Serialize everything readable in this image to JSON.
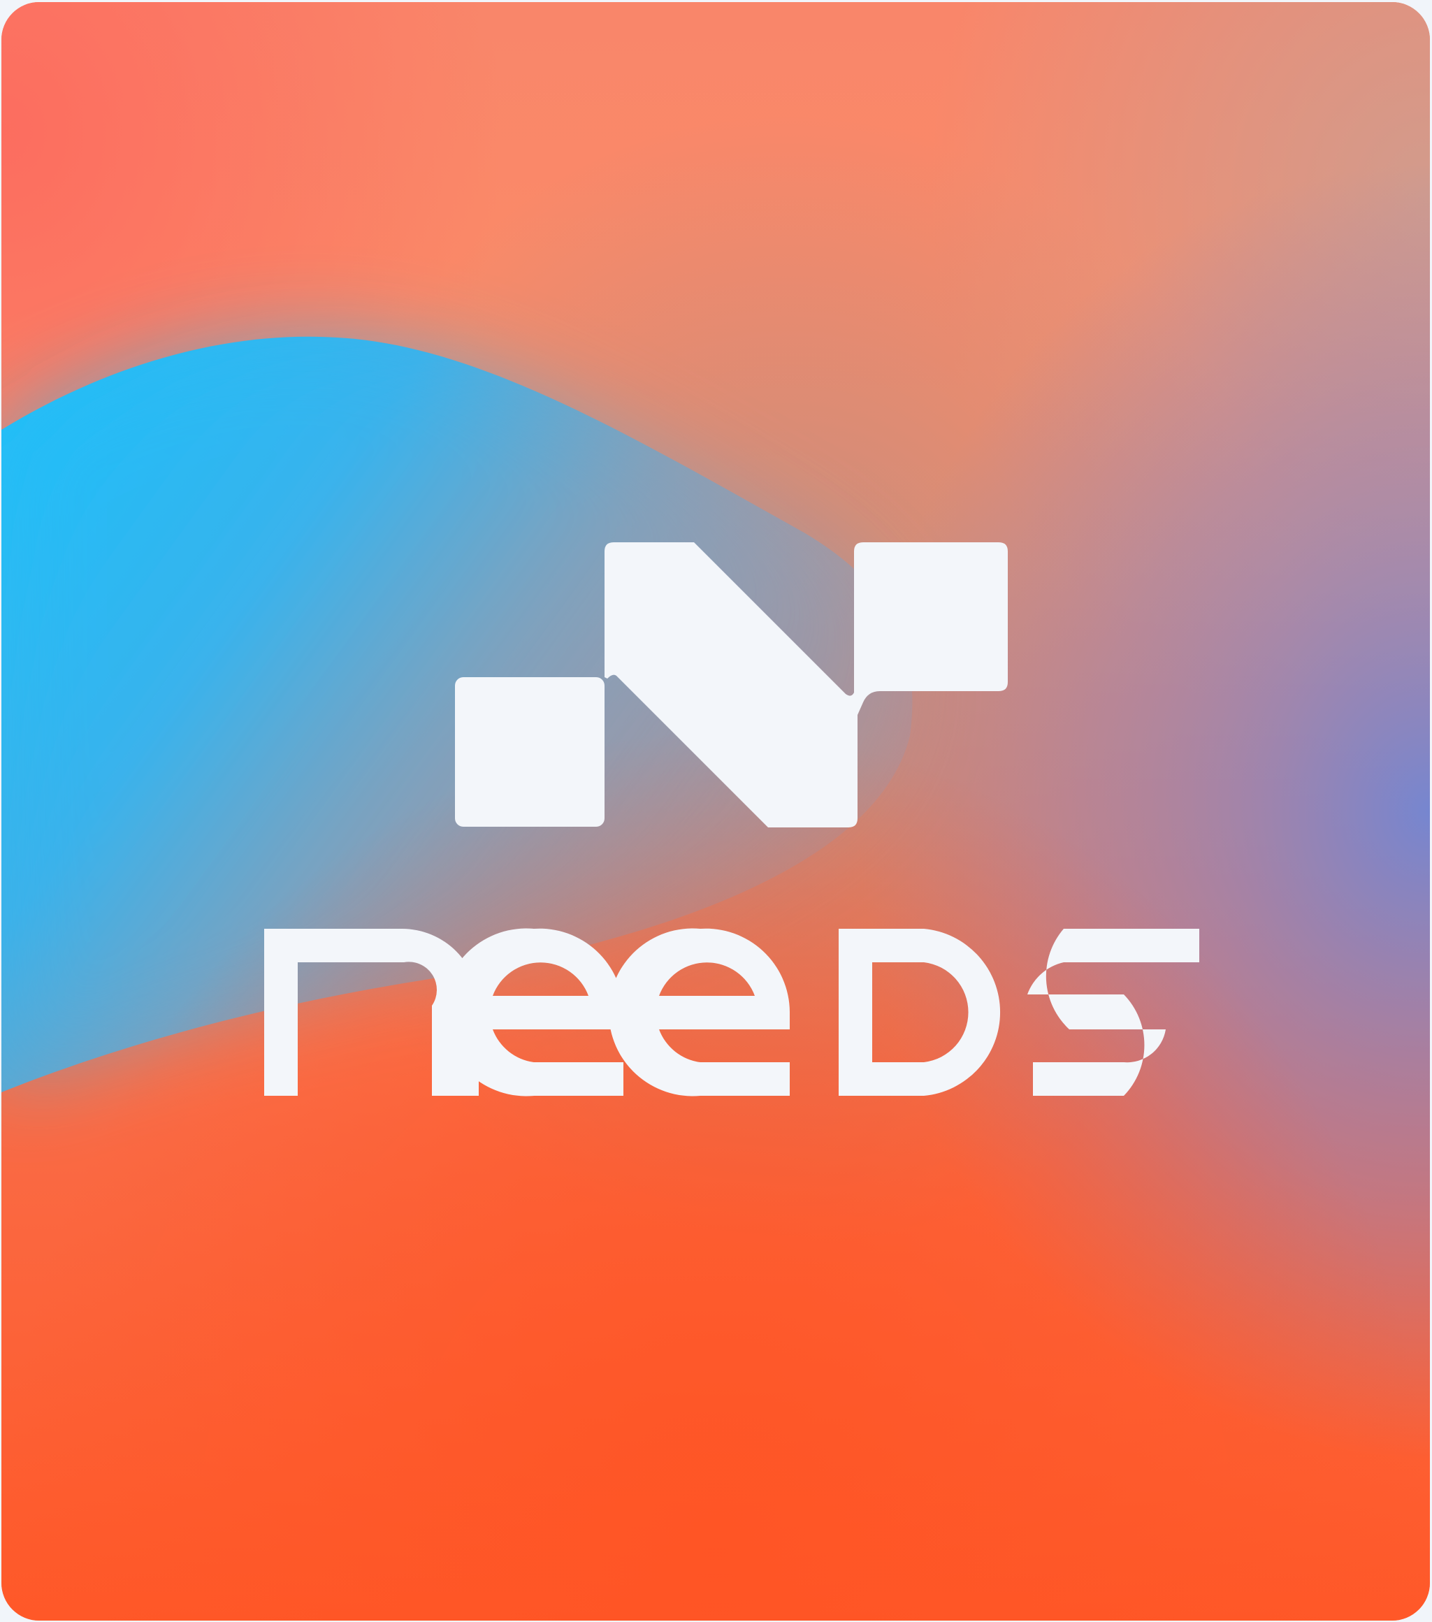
{
  "brand": {
    "name": "needs",
    "mark_icon": "n-monogram-icon"
  },
  "colors": {
    "logo_fill": "#f3f6fa",
    "page_background": "#f1f5fa",
    "gradient_orange": "#fb8a64",
    "gradient_red_orange": "#ff5a2a",
    "gradient_blue": "#1ec3ff",
    "gradient_violet": "#7e86c4"
  }
}
